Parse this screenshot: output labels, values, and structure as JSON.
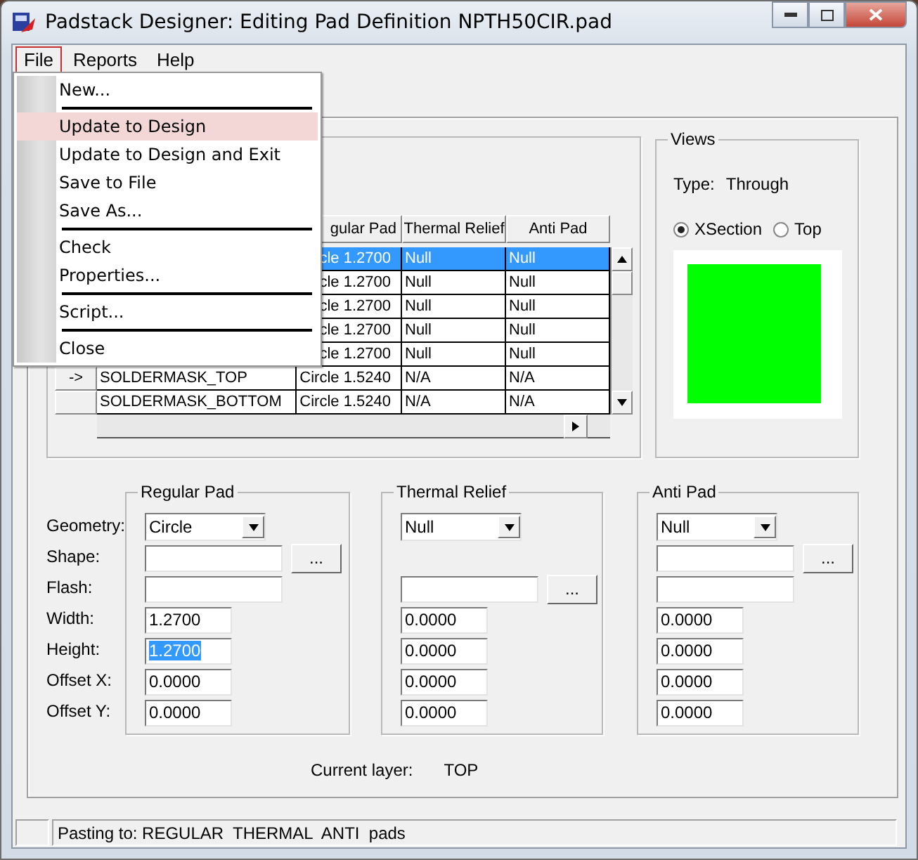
{
  "window": {
    "title": "Padstack Designer: Editing Pad Definition NPTH50CIR.pad"
  },
  "menubar": [
    {
      "label": "File",
      "selected": true
    },
    {
      "label": "Reports",
      "selected": false
    },
    {
      "label": "Help",
      "selected": false
    }
  ],
  "file_menu": [
    {
      "kind": "item",
      "label": "New...",
      "selected": false
    },
    {
      "kind": "separator"
    },
    {
      "kind": "item",
      "label": "Update to Design",
      "selected": true
    },
    {
      "kind": "item",
      "label": "Update to Design and Exit",
      "selected": false
    },
    {
      "kind": "item",
      "label": "Save to File",
      "selected": false
    },
    {
      "kind": "item",
      "label": "Save As...",
      "selected": false
    },
    {
      "kind": "separator"
    },
    {
      "kind": "item",
      "label": "Check",
      "selected": false
    },
    {
      "kind": "item",
      "label": "Properties...",
      "selected": false
    },
    {
      "kind": "separator"
    },
    {
      "kind": "item",
      "label": "Script...",
      "selected": false
    },
    {
      "kind": "separator"
    },
    {
      "kind": "item",
      "label": "Close",
      "selected": false
    }
  ],
  "layer_table": {
    "columns": [
      "gular Pad",
      "Thermal Relief",
      "Anti Pad"
    ],
    "rows": [
      {
        "regular": "cle 1.2700",
        "thermal": "Null",
        "anti": "Null",
        "selected": true
      },
      {
        "regular": "cle 1.2700",
        "thermal": "Null",
        "anti": "Null",
        "selected": false
      },
      {
        "regular": "cle 1.2700",
        "thermal": "Null",
        "anti": "Null",
        "selected": false
      },
      {
        "regular": "cle 1.2700",
        "thermal": "Null",
        "anti": "Null",
        "selected": false
      },
      {
        "regular": "cle 1.2700",
        "thermal": "Null",
        "anti": "Null",
        "selected": false
      },
      {
        "marker": "->",
        "layer": "SOLDERMASK_TOP",
        "regular": "Circle 1.5240",
        "thermal": "N/A",
        "anti": "N/A",
        "selected": false
      },
      {
        "marker": "",
        "layer": "SOLDERMASK_BOTTOM",
        "regular": "Circle 1.5240",
        "thermal": "N/A",
        "anti": "N/A",
        "selected": false
      }
    ]
  },
  "views": {
    "title": "Views",
    "type_label": "Type:",
    "type_value": "Through",
    "options": [
      {
        "label": "XSection",
        "selected": true
      },
      {
        "label": "Top",
        "selected": false
      }
    ]
  },
  "row_labels": [
    "Geometry:",
    "Shape:",
    "Flash:",
    "Width:",
    "Height:",
    "Offset X:",
    "Offset Y:"
  ],
  "pad_groups": [
    {
      "title": "Regular Pad",
      "fields": [
        {
          "kind": "select",
          "value": "Circle"
        },
        {
          "kind": "browse",
          "button": "..."
        },
        {
          "kind": "text"
        },
        {
          "kind": "number",
          "value": "1.2700"
        },
        {
          "kind": "number",
          "value": "1.2700",
          "highlighted": true
        },
        {
          "kind": "number",
          "value": "0.0000"
        },
        {
          "kind": "number",
          "value": "0.0000"
        }
      ]
    },
    {
      "title": "Thermal Relief",
      "fields": [
        {
          "kind": "select",
          "value": "Null"
        },
        {
          "kind": "blank"
        },
        {
          "kind": "browse",
          "button": "..."
        },
        {
          "kind": "number",
          "value": "0.0000"
        },
        {
          "kind": "number",
          "value": "0.0000"
        },
        {
          "kind": "number",
          "value": "0.0000"
        },
        {
          "kind": "number",
          "value": "0.0000"
        }
      ]
    },
    {
      "title": "Anti Pad",
      "fields": [
        {
          "kind": "select",
          "value": "Null"
        },
        {
          "kind": "browse",
          "button": "..."
        },
        {
          "kind": "text"
        },
        {
          "kind": "number",
          "value": "0.0000"
        },
        {
          "kind": "number",
          "value": "0.0000"
        },
        {
          "kind": "number",
          "value": "0.0000"
        },
        {
          "kind": "number",
          "value": "0.0000"
        }
      ]
    }
  ],
  "current_layer": {
    "label": "Current layer:",
    "value": "TOP"
  },
  "status_bar": "Pasting to: REGULAR  THERMAL  ANTI  pads"
}
